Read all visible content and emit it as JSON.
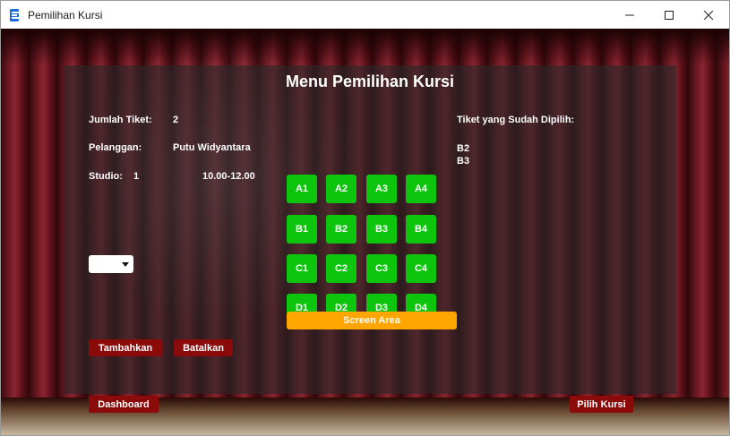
{
  "window": {
    "title": "Pemilihan Kursi"
  },
  "page": {
    "heading": "Menu Pemilihan Kursi"
  },
  "info": {
    "jumlah_label": "Jumlah Tiket:",
    "jumlah_value": "2",
    "pelanggan_label": "Pelanggan:",
    "pelanggan_value": "Putu Widyantara",
    "studio_label": "Studio:",
    "studio_value": "1",
    "time_value": "10.00-12.00"
  },
  "dropdown": {
    "selected": ""
  },
  "buttons": {
    "tambahkan": "Tambahkan",
    "batalkan": "Batalkan",
    "dashboard": "Dashboard",
    "pilih": "Pilih Kursi"
  },
  "seats": [
    [
      "A1",
      "A2",
      "A3",
      "A4"
    ],
    [
      "B1",
      "B2",
      "B3",
      "B4"
    ],
    [
      "C1",
      "C2",
      "C3",
      "C4"
    ],
    [
      "D1",
      "D2",
      "D3",
      "D4"
    ]
  ],
  "screen_label": "Screen Area",
  "selected_tickets": {
    "label": "Tiket yang Sudah Dipilih:",
    "items": [
      "B2",
      "B3"
    ]
  },
  "colors": {
    "seat": "#0ec50e",
    "button": "#8b0a0a",
    "screen": "#ffa500"
  }
}
